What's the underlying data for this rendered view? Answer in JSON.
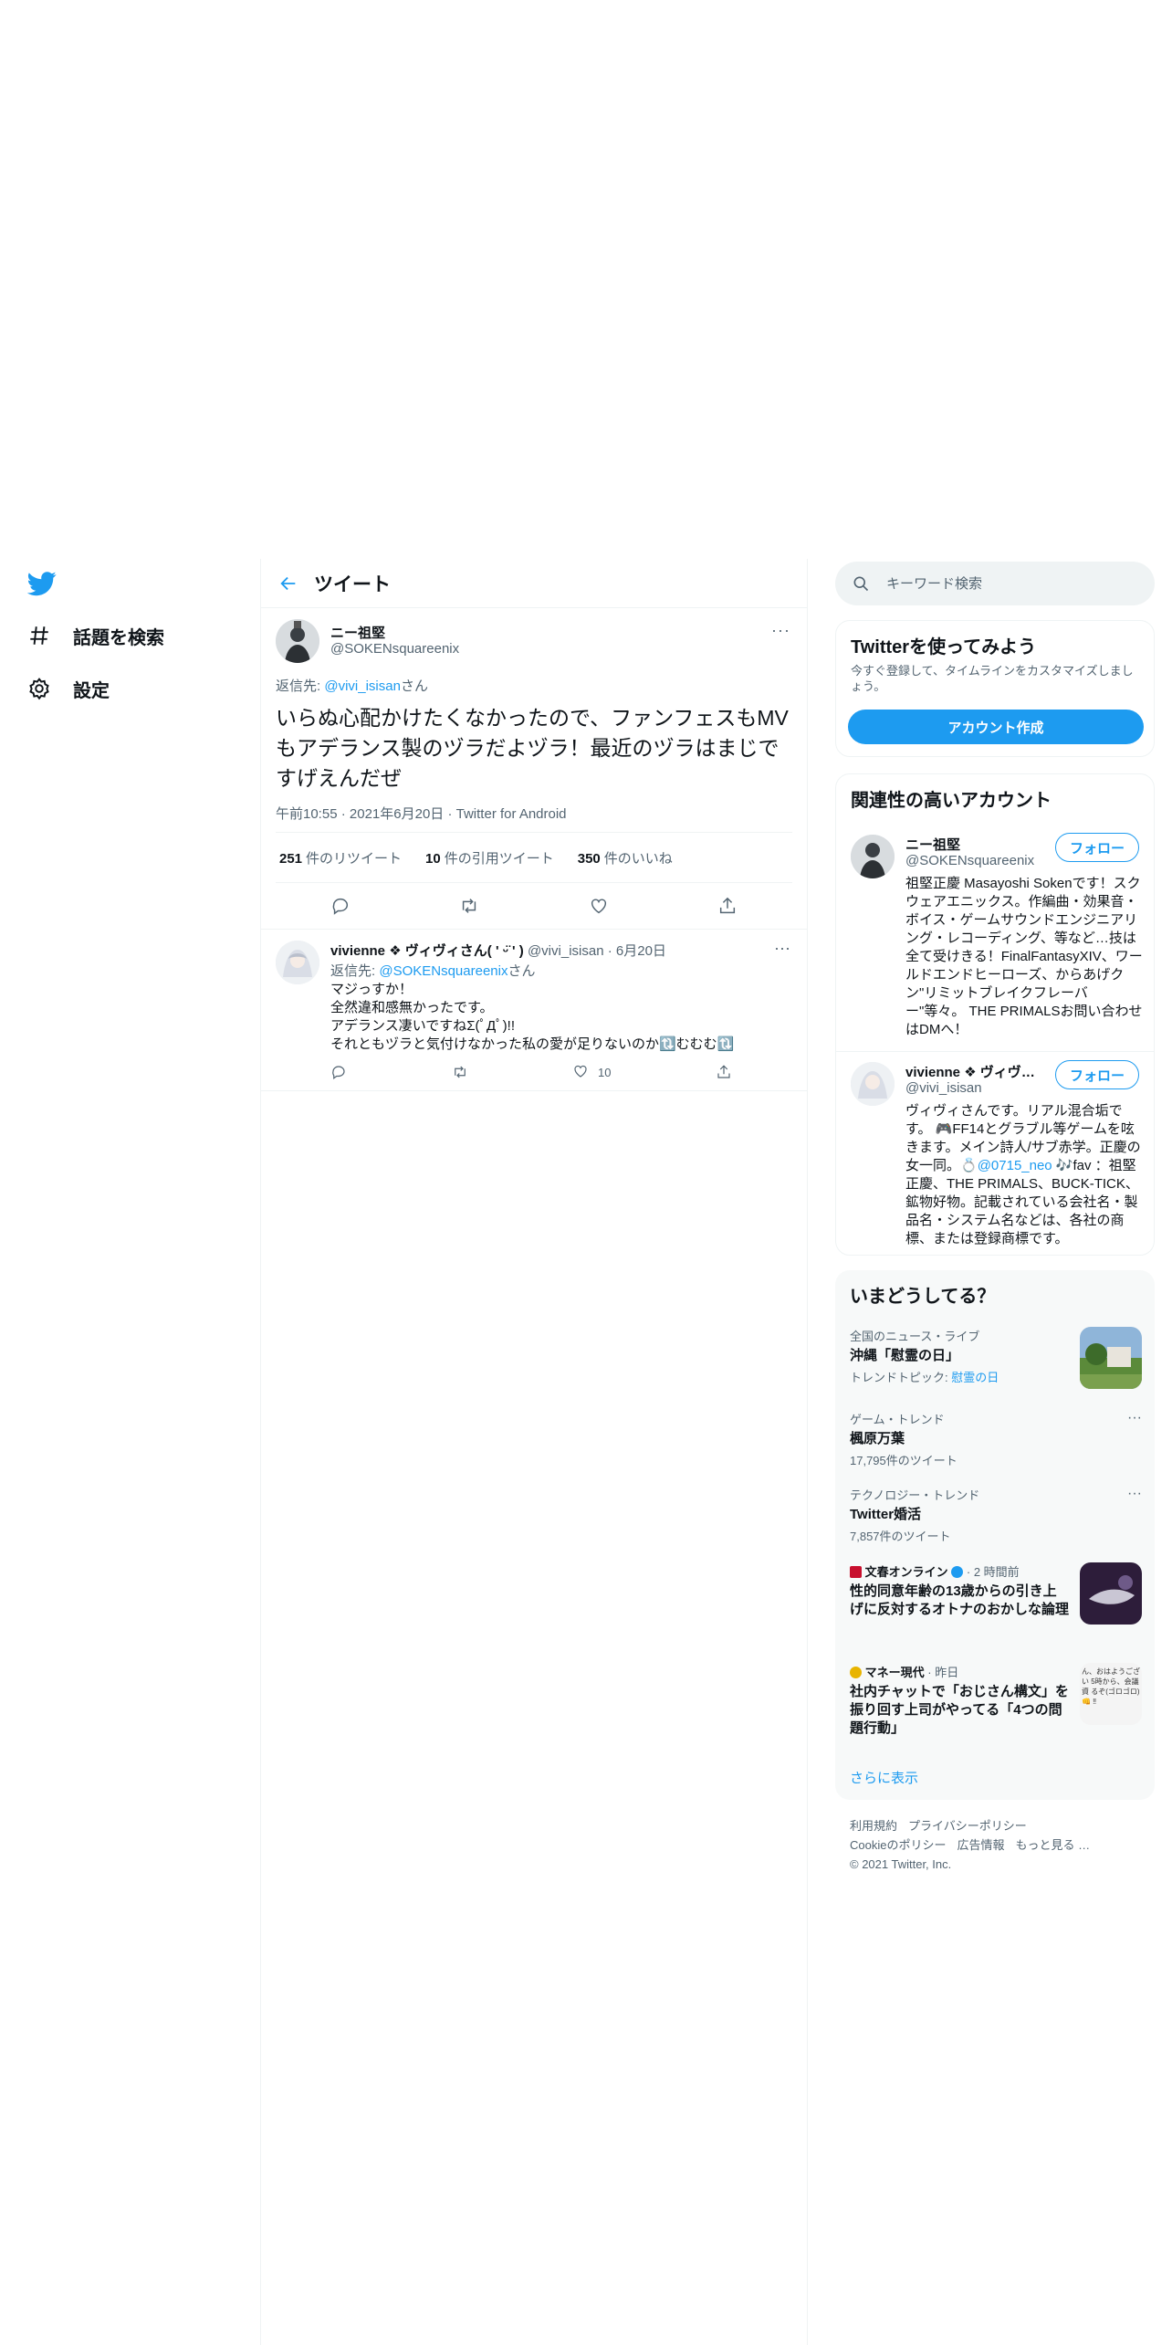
{
  "nav": {
    "explore": "話題を検索",
    "settings": "設定"
  },
  "header": {
    "title": "ツイート"
  },
  "tweet": {
    "name": "ニー祖堅",
    "handle": "@SOKENsquareenix",
    "reply_prefix": "返信先: ",
    "reply_handle": "@vivi_isisan",
    "reply_suffix": "さん",
    "text": "いらぬ心配かけたくなかったので、ファンフェスもMVもアデランス製のヅラだよヅラ！最近のヅラはまじですげえんだぜ",
    "time": "午前10:55",
    "date": "2021年6月20日",
    "source": "Twitter for Android",
    "retweets": "251",
    "retweets_label": "件のリツイート",
    "quotes": "10",
    "quotes_label": "件の引用ツイート",
    "likes": "350",
    "likes_label": "件のいいね"
  },
  "reply": {
    "name": "vivienne ❖ ヴィヴィさん( ' ᵕ̈ ' )",
    "handle": "@vivi_isisan",
    "date": "6月20日",
    "reply_prefix": "返信先: ",
    "reply_handle": "@SOKENsquareenix",
    "reply_suffix": "さん",
    "lines": [
      "マジっすか！",
      "全然違和感無かったです。",
      "アデランス凄いですねΣ(ﾟДﾟ)!!",
      "それともヅラと気付けなかった私の愛が足りないのか🔃むむむ🔃"
    ],
    "like_count": "10"
  },
  "search": {
    "placeholder": "キーワード検索"
  },
  "signup": {
    "title": "Twitterを使ってみよう",
    "desc": "今すぐ登録して、タイムラインをカスタマイズしましょう。",
    "button": "アカウント作成"
  },
  "related": {
    "title": "関連性の高いアカウント",
    "follow_label": "フォロー",
    "accounts": [
      {
        "name": "ニー祖堅",
        "handle": "@SOKENsquareenix",
        "bio": "祖堅正慶 Masayoshi Sokenです！スクウェアエニックス。作編曲・効果音・ボイス・ゲームサウンドエンジニアリング・レコーディング、等など…技は全て受けきる！FinalFantasyXIV、ワールドエンドヒーローズ、からあげクン\"リミットブレイクフレーバー\"等々。 THE PRIMALSお問い合わせはDMへ！"
      },
      {
        "name": "vivienne ❖ ヴィヴィさん( ' ᵕ̈ ' )",
        "handle": "@vivi_isisan",
        "bio_pre": "ヴィヴィさんです。リアル混合垢です。 🎮FF14とグラブル等ゲームを呟きます。メイン詩人/サブ赤学。正慶の女一同。💍",
        "bio_link": "@0715_neo",
        "bio_post": " 🎶fav ：祖堅正慶、THE PRIMALS、BUCK-TICK、鉱物好物。記載されている会社名・製品名・システム名などは、各社の商標、または登録商標です。"
      }
    ]
  },
  "trends": {
    "title": "いまどうしてる？",
    "items": [
      {
        "context": "全国のニュース・ライブ",
        "title": "沖縄「慰霊の日」",
        "sub_prefix": "トレンドトピック: ",
        "sub_link": "慰霊の日"
      },
      {
        "context": "ゲーム・トレンド",
        "title": "楓原万葉",
        "sub": "17,795件のツイート"
      },
      {
        "context": "テクノロジー・トレンド",
        "title": "Twitter婚活",
        "sub": "7,857件のツイート"
      },
      {
        "source": "文春オンライン",
        "time": "2 時間前",
        "title": "性的同意年齢の13歳からの引き上げに反対するオトナのおかしな論理"
      },
      {
        "source": "マネー現代",
        "time": "昨日",
        "title": "社内チャットで「おじさん構文」を振り回す上司がやってる「4つの問題行動」",
        "thumb_text": "ん、おはようござい 5時から、会議資 るぞ(ゴロゴロ)👊 ‼"
      }
    ],
    "show_more": "さらに表示"
  },
  "footer": {
    "links_row1": [
      "利用規約",
      "プライバシーポリシー"
    ],
    "links_row2": [
      "Cookieのポリシー",
      "広告情報",
      "もっと見る …"
    ],
    "copyright": "© 2021 Twitter, Inc."
  },
  "colors": {
    "accent": "#1d9bf0",
    "text": "#0f1419",
    "secondary": "#536471",
    "border": "#eff3f4"
  }
}
